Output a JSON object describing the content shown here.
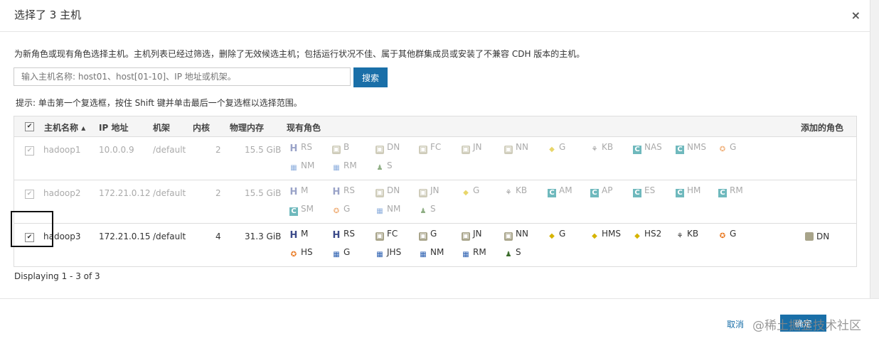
{
  "dialog": {
    "title": "选择了 3 主机",
    "close_symbol": "×",
    "description": "为新角色或现有角色选择主机。主机列表已经过筛选，删除了无效候选主机；包括运行状况不佳、属于其他群集成员或安装了不兼容 CDH 版本的主机。",
    "hint": "提示: 单击第一个复选框，按住 Shift 键并单击最后一个复选框以选择范围。"
  },
  "search": {
    "placeholder": "输入主机名称: host01、host[01-10]、IP 地址或机架。",
    "button_label": "搜索"
  },
  "table": {
    "headers": {
      "hostname": "主机名称",
      "ip": "IP 地址",
      "rack": "机架",
      "cores": "内核",
      "memory": "物理内存",
      "roles": "现有角色",
      "added_roles": "添加的角色"
    },
    "rows": [
      {
        "hostname": "hadoop1",
        "ip": "10.0.0.9",
        "rack": "/default",
        "cores": "2",
        "memory": "15.5 GiB",
        "checked": true,
        "disabled": true,
        "roles_line1": [
          [
            "h",
            "RS"
          ],
          [
            "sq",
            "B"
          ],
          [
            "sq",
            "DN"
          ],
          [
            "sq",
            "FC"
          ],
          [
            "sq",
            "JN"
          ],
          [
            "sq",
            "NN"
          ],
          [
            "hive",
            "G"
          ],
          [
            "kb",
            "KB"
          ],
          [
            "c",
            "NAS"
          ],
          [
            "c",
            "NMS"
          ],
          [
            "star",
            "G"
          ]
        ],
        "roles_line2": [
          [
            "grid",
            "NM"
          ],
          [
            "grid",
            "RM"
          ],
          [
            "man",
            "S"
          ]
        ],
        "added": ""
      },
      {
        "hostname": "hadoop2",
        "ip": "172.21.0.12",
        "rack": "/default",
        "cores": "2",
        "memory": "15.5 GiB",
        "checked": true,
        "disabled": true,
        "roles_line1": [
          [
            "h",
            "M"
          ],
          [
            "h",
            "RS"
          ],
          [
            "sq",
            "DN"
          ],
          [
            "sq",
            "JN"
          ],
          [
            "hive",
            "G"
          ],
          [
            "kb",
            "KB"
          ],
          [
            "c",
            "AM"
          ],
          [
            "c",
            "AP"
          ],
          [
            "c",
            "ES"
          ],
          [
            "c",
            "HM"
          ],
          [
            "c",
            "RM"
          ]
        ],
        "roles_line2": [
          [
            "c",
            "SM"
          ],
          [
            "star",
            "G"
          ],
          [
            "grid",
            "NM"
          ],
          [
            "man",
            "S"
          ]
        ],
        "added": ""
      },
      {
        "hostname": "hadoop3",
        "ip": "172.21.0.15",
        "rack": "/default",
        "cores": "4",
        "memory": "31.3 GiB",
        "checked": true,
        "disabled": false,
        "roles_line1": [
          [
            "h",
            "M"
          ],
          [
            "h",
            "RS"
          ],
          [
            "sq",
            "FC"
          ],
          [
            "sq",
            "G"
          ],
          [
            "sq",
            "JN"
          ],
          [
            "sq",
            "NN"
          ],
          [
            "hive",
            "G"
          ],
          [
            "hive",
            "HMS"
          ],
          [
            "hive",
            "HS2"
          ],
          [
            "kb",
            "KB"
          ],
          [
            "star",
            "G"
          ]
        ],
        "roles_line2": [
          [
            "star",
            "HS"
          ],
          [
            "grid",
            "G"
          ],
          [
            "grid",
            "JHS"
          ],
          [
            "grid",
            "NM"
          ],
          [
            "grid",
            "RM"
          ],
          [
            "man",
            "S"
          ]
        ],
        "added": "DN"
      }
    ]
  },
  "displaying": "Displaying 1 - 3 of 3",
  "footer": {
    "cancel_label": "取消",
    "ok_label": "确定",
    "watermark": "@稀土掘金技术社区"
  },
  "icon_map": {
    "h": "H",
    "sq": "▣",
    "c": "C",
    "star": "✪",
    "grid": "▦",
    "hive": "◆",
    "kb": "⚘",
    "man": "♟"
  }
}
